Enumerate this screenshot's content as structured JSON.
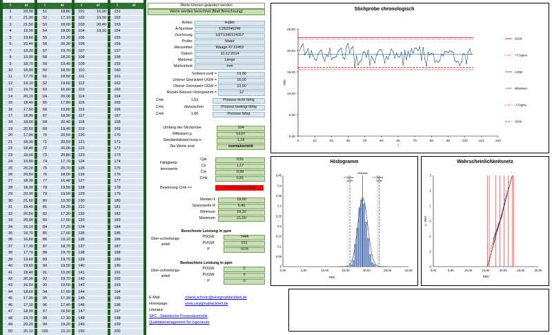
{
  "headers": {
    "n1": "i",
    "x1": "xi",
    "n2": "i",
    "x2": "xi",
    "n3": "i",
    "x3": "xi",
    "n4": "i",
    "x4": "xi"
  },
  "table": {
    "col1": [
      [
        "1",
        "20,00"
      ],
      [
        "2",
        "21,00"
      ],
      [
        "3",
        "21,50"
      ],
      [
        "4",
        "19,00"
      ],
      [
        "5",
        "19,60"
      ],
      [
        "6",
        "20,40"
      ],
      [
        "7",
        "18,30"
      ],
      [
        "8",
        "19,90"
      ],
      [
        "9",
        "18,70"
      ],
      [
        "10",
        "18,00"
      ],
      [
        "11",
        "17,70"
      ],
      [
        "12",
        "19,10"
      ],
      [
        "13",
        "19,70"
      ],
      [
        "14",
        "20,10"
      ],
      [
        "15",
        "18,40"
      ],
      [
        "16",
        "17,50"
      ],
      [
        "17",
        "18,90"
      ],
      [
        "18",
        "18,60"
      ],
      [
        "19",
        "20,50"
      ],
      [
        "20",
        "17,90"
      ],
      [
        "21",
        "18,30"
      ],
      [
        "22",
        "18,40"
      ],
      [
        "23",
        "18,60"
      ],
      [
        "24",
        "19,80"
      ],
      [
        "25",
        "20,20"
      ],
      [
        "26",
        "20,50"
      ],
      [
        "27",
        "18,30"
      ],
      [
        "28",
        "18,00"
      ],
      [
        "29",
        "20,90"
      ],
      [
        "30",
        "21,60"
      ],
      [
        "31",
        "19,40"
      ],
      [
        "32",
        "20,50"
      ],
      [
        "33",
        "20,90"
      ],
      [
        "34",
        "16,10"
      ],
      [
        "35",
        "18,70"
      ],
      [
        "36",
        "16,60"
      ],
      [
        "37",
        "17,30"
      ],
      [
        "38",
        "17,70"
      ],
      [
        "39",
        "19,60"
      ],
      [
        "40",
        "19,60"
      ],
      [
        "41",
        "18,40"
      ],
      [
        "42",
        "20,00"
      ],
      [
        "43",
        "16,50"
      ],
      [
        "44",
        "18,60"
      ],
      [
        "45",
        "17,90"
      ],
      [
        "46",
        "17,10"
      ],
      [
        "47",
        "18,90"
      ],
      [
        "48",
        "19,70"
      ],
      [
        "49",
        "20,20"
      ],
      [
        "50",
        "20,10"
      ]
    ],
    "col2": [
      [
        "51",
        "18,80"
      ],
      [
        "52",
        "17,10"
      ],
      [
        "53",
        "18,60"
      ],
      [
        "54",
        "18,00"
      ],
      [
        "55",
        "19,20"
      ],
      [
        "56",
        "20,30"
      ],
      [
        "57",
        "19,70"
      ],
      [
        "58",
        "18,20"
      ],
      [
        "59",
        "19,40"
      ],
      [
        "60",
        "18,50"
      ],
      [
        "61",
        "18,50"
      ],
      [
        "62",
        "19,60"
      ],
      [
        "63",
        "16,60"
      ],
      [
        "64",
        "20,00"
      ],
      [
        "65",
        "17,80"
      ],
      [
        "66",
        "19,80"
      ],
      [
        "67",
        "18,50"
      ],
      [
        "68",
        "20,40"
      ],
      [
        "69",
        "19,40"
      ],
      [
        "70",
        "20,50"
      ],
      [
        "71",
        "20,50"
      ],
      [
        "72",
        "20,00"
      ],
      [
        "73",
        "20,80"
      ],
      [
        "74",
        "17,70"
      ],
      [
        "75",
        "20,70"
      ],
      [
        "76",
        "18,00"
      ],
      [
        "77",
        "16,40"
      ],
      [
        "78",
        "19,50"
      ],
      [
        "79",
        "19,00"
      ],
      [
        "80",
        "19,30"
      ],
      [
        "81",
        "19,20"
      ],
      [
        "82",
        "17,30"
      ],
      [
        "83",
        "17,60"
      ],
      [
        "84",
        "17,20"
      ],
      [
        "85",
        "17,60"
      ],
      [
        "86",
        "19,10"
      ],
      [
        "87",
        "18,70"
      ],
      [
        "88",
        "19,70"
      ],
      [
        "89",
        "19,70"
      ],
      [
        "90",
        "19,50"
      ],
      [
        "91",
        "19,90"
      ],
      [
        "92",
        "19,70"
      ],
      [
        "93",
        "19,60"
      ],
      [
        "94",
        "17,60"
      ],
      [
        "95",
        "17,30"
      ],
      [
        "96",
        "17,40"
      ],
      [
        "97",
        "16,50"
      ],
      [
        "98",
        "17,30"
      ],
      [
        "99",
        "19,20"
      ],
      [
        "100",
        "19,10"
      ]
    ],
    "col3": [
      [
        "101",
        "16,90"
      ],
      [
        "102",
        "19,50"
      ],
      [
        "103",
        "20,40"
      ],
      [
        "104",
        "19,10"
      ],
      [
        "105",
        ""
      ],
      [
        "106",
        ""
      ],
      [
        "107",
        ""
      ],
      [
        "108",
        ""
      ],
      [
        "109",
        ""
      ],
      [
        "110",
        ""
      ],
      [
        "111",
        ""
      ],
      [
        "112",
        ""
      ],
      [
        "113",
        ""
      ],
      [
        "114",
        ""
      ],
      [
        "115",
        ""
      ],
      [
        "116",
        ""
      ],
      [
        "117",
        ""
      ],
      [
        "118",
        ""
      ],
      [
        "119",
        ""
      ],
      [
        "120",
        ""
      ],
      [
        "121",
        ""
      ],
      [
        "122",
        ""
      ],
      [
        "123",
        ""
      ],
      [
        "124",
        ""
      ],
      [
        "125",
        ""
      ],
      [
        "126",
        ""
      ],
      [
        "127",
        ""
      ],
      [
        "128",
        ""
      ],
      [
        "129",
        ""
      ],
      [
        "130",
        ""
      ],
      [
        "131",
        ""
      ],
      [
        "132",
        ""
      ],
      [
        "133",
        ""
      ],
      [
        "134",
        ""
      ],
      [
        "135",
        ""
      ],
      [
        "136",
        ""
      ],
      [
        "137",
        ""
      ],
      [
        "138",
        ""
      ],
      [
        "139",
        ""
      ],
      [
        "140",
        ""
      ],
      [
        "141",
        ""
      ],
      [
        "142",
        ""
      ],
      [
        "143",
        ""
      ],
      [
        "144",
        ""
      ],
      [
        "145",
        ""
      ],
      [
        "146",
        ""
      ],
      [
        "147",
        ""
      ],
      [
        "148",
        ""
      ],
      [
        "149",
        ""
      ],
      [
        "150",
        ""
      ]
    ],
    "col4": [
      "151",
      "152",
      "153",
      "154",
      "155",
      "156",
      "157",
      "158",
      "159",
      "160",
      "161",
      "162",
      "163",
      "164",
      "165",
      "166",
      "167",
      "168",
      "169",
      "170",
      "171",
      "172",
      "173",
      "174",
      "175",
      "176",
      "177",
      "178",
      "179",
      "180",
      "181",
      "182",
      "183",
      "184",
      "185",
      "186",
      "187",
      "188",
      "189",
      "190",
      "191",
      "192",
      "193",
      "194",
      "195",
      "196",
      "197",
      "198",
      "199",
      "200"
    ]
  },
  "status": {
    "line1": "Werte können geändert werden",
    "line2": "Werte werden berechnet (Blatt Berechnung)"
  },
  "info": [
    {
      "label": "Artikel:",
      "value": "Halter"
    },
    {
      "label": "A-Nummer",
      "value": "C262346248"
    },
    {
      "label": "Zeichnung:",
      "value": "UZT1340124357"
    },
    {
      "label": "Prüfer:",
      "value": "Maier"
    },
    {
      "label": "Messmittel:",
      "value": "Waage 47.22452"
    },
    {
      "label": "Datum:",
      "value": "10.12.2014"
    },
    {
      "label": "Merkmal:",
      "value": "Länge"
    },
    {
      "label": "Maßeinheit:",
      "value": "mm"
    }
  ],
  "limits": [
    {
      "label": "Sollwert xsoll =",
      "value": "19,00"
    },
    {
      "label": "Unterer Grenzwert UGW =",
      "value": "16,00"
    },
    {
      "label": "Oberer Grenzwert OGW =",
      "value": "23,00"
    },
    {
      "label": "Anzahl Klassen Histogramm =",
      "value": "12"
    }
  ],
  "capability": [
    {
      "label": "Cmk",
      "mid": "",
      "value": "1,53",
      "text": "Prozess nicht fähig"
    },
    {
      "label": "Cmk",
      "mid": "dazwischen",
      "value": "",
      "text": "Prozess bedingt fähig"
    },
    {
      "label": "Cmk",
      "mid": "",
      "value": "1,66",
      "text": "Prozess fähig"
    }
  ],
  "stats": [
    {
      "label": "Umfang der Stichprobe",
      "value": "104"
    },
    {
      "label": "Mittelwert µ",
      "value": "19,07"
    },
    {
      "label": "Standardabweichung σ",
      "value": "1,18"
    },
    {
      "label": "Die Werte sind",
      "value": "normalverteilt"
    }
  ],
  "faehig": {
    "title": "Fähigkeits-kennwerte",
    "rows": [
      {
        "k": "Cpk",
        "v": "0,81"
      },
      {
        "k": "Cp",
        "v": "1,17"
      },
      {
        "k": "Cm",
        "v": "0,99"
      },
      {
        "k": "Cmk",
        "v": "0,81"
      }
    ],
    "bew_label": "Bewertung Cmk =>",
    "bew_value": "Prozess nicht fähig"
  },
  "median": [
    {
      "label": "Median x̃",
      "value": "18,90"
    },
    {
      "label": "Spannweite R",
      "value": "5,40"
    },
    {
      "label": "Minimum",
      "value": "16,10"
    },
    {
      "label": "Maximum",
      "value": "21,50"
    }
  ],
  "ber": {
    "title": "Berechnete Leistung in ppm",
    "side": "Über-schreitungs-anteil",
    "rows": [
      {
        "k": "POGW",
        "v": "7444"
      },
      {
        "k": "PUGW",
        "v": "231"
      },
      {
        "k": "P",
        "v": "7675"
      }
    ]
  },
  "beo": {
    "title": "Beobachtete Leistung in ppm",
    "side": "Über-schreitungs-anteil",
    "rows": [
      {
        "k": "POGW",
        "v": "0"
      },
      {
        "k": "PUGW",
        "v": "0"
      },
      {
        "k": "P",
        "v": "0"
      }
    ]
  },
  "footer": {
    "email_label": "E-Mail:",
    "email": "roland.schnurr@sixsigmablackbelt.de",
    "home_label": "Homepage:",
    "home": "www.sixsigmablackbelt.de",
    "lit_label": "Literatur:",
    "lit1": "SPC - Statistische Prozesskontrolle",
    "lit2": "Qualitätsmanagement für Ingenieure"
  },
  "chart_data": [
    {
      "type": "line",
      "title": "Stichprobe chronologisch",
      "xlabel": "i",
      "ylabel": "mm",
      "xlim": [
        0,
        120
      ],
      "ylim": [
        0,
        25
      ],
      "xticks": [
        "0",
        "10",
        "20",
        "30",
        "40",
        "50",
        "60",
        "70",
        "80",
        "90",
        "100",
        "110",
        "120"
      ],
      "yticks": [
        "0,00",
        "5,00",
        "10,00",
        "15,00",
        "20,00",
        "25,00"
      ],
      "ogw": 23,
      "ugw": 16,
      "mean": 19.07,
      "plus3": 22.6,
      "minus3": 15.5,
      "legend": [
        "OGW",
        "+3 Sigma",
        "Länge",
        "Mittelwert",
        "-3 Sigma",
        "UGW"
      ],
      "colors": {
        "ogw": "#c00000",
        "plus3": "#c00000",
        "line": "#1f4e79",
        "mean": "#2e75b6",
        "minus3": "#c00000",
        "ugw": "#c00000"
      }
    },
    {
      "type": "bar",
      "title": "Histogramm",
      "xlabel": "mm",
      "xlim": [
        0,
        30
      ],
      "ylim": [
        0,
        0.45
      ],
      "xticks": [
        "0,00",
        "5,00",
        "10,00",
        "15,00",
        "20,00",
        "25,00",
        "30,00"
      ],
      "yticks": [
        "0",
        "0,05",
        "0,1",
        "0,15",
        "0,2",
        "0,25",
        "0,3",
        "0,35",
        "0,4",
        "0,45"
      ],
      "annotations": [
        "Mittelwert",
        "- 3 Sigma",
        "+ 3 Sigma",
        "UGW",
        "OGW"
      ]
    },
    {
      "type": "scatter",
      "title": "Wahrscheinlichkeitsnetz",
      "xlabel": "mm",
      "ylabel": "u - Wert",
      "xlim": [
        0,
        30
      ],
      "ylim": [
        -3,
        3
      ],
      "xticks": [
        "0,00",
        "5,00",
        "10,00",
        "15,00",
        "20,00",
        "25,00",
        "30,00"
      ],
      "yticks": [
        "-3",
        "-2",
        "-1",
        "0",
        "1",
        "2",
        "3"
      ]
    }
  ]
}
